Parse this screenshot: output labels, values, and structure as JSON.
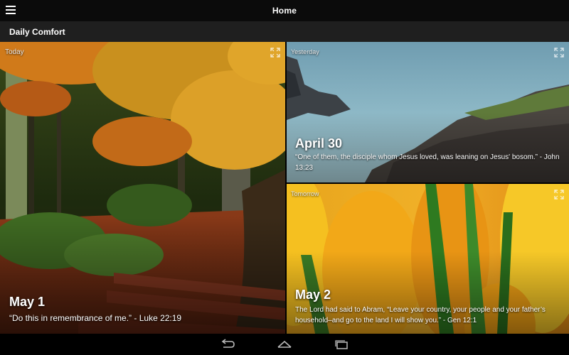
{
  "actionbar": {
    "title": "Home",
    "menu_icon": "hamburger-menu-icon"
  },
  "section": {
    "title": "Daily Comfort"
  },
  "tiles": {
    "today": {
      "day": "Today",
      "date": "May 1",
      "verse": "“Do this in remembrance of me.” - Luke 22:19",
      "image": "autumn-park-bench",
      "expand_icon": "expand-icon"
    },
    "yesterday": {
      "day": "Yesterday",
      "date": "April 30",
      "verse": "“One of them, the disciple whom Jesus loved, was leaning on Jesus' bosom.” - John 13:23",
      "image": "misty-sea-rocks",
      "expand_icon": "expand-icon"
    },
    "tomorrow": {
      "day": "Tomorrow",
      "date": "May 2",
      "verse": "The Lord had said to Abram, “Leave your country, your people and your father’s household–and go to the land I will show you.” - Gen 12:1",
      "image": "yellow-tulips",
      "expand_icon": "expand-icon"
    }
  },
  "navbar": {
    "back_icon": "back-icon",
    "home_icon": "home-icon",
    "recents_icon": "recents-icon"
  },
  "colors": {
    "actionbar_bg": "#0b0b0b",
    "section_bg": "#1f1f1f",
    "text": "#ffffff"
  }
}
